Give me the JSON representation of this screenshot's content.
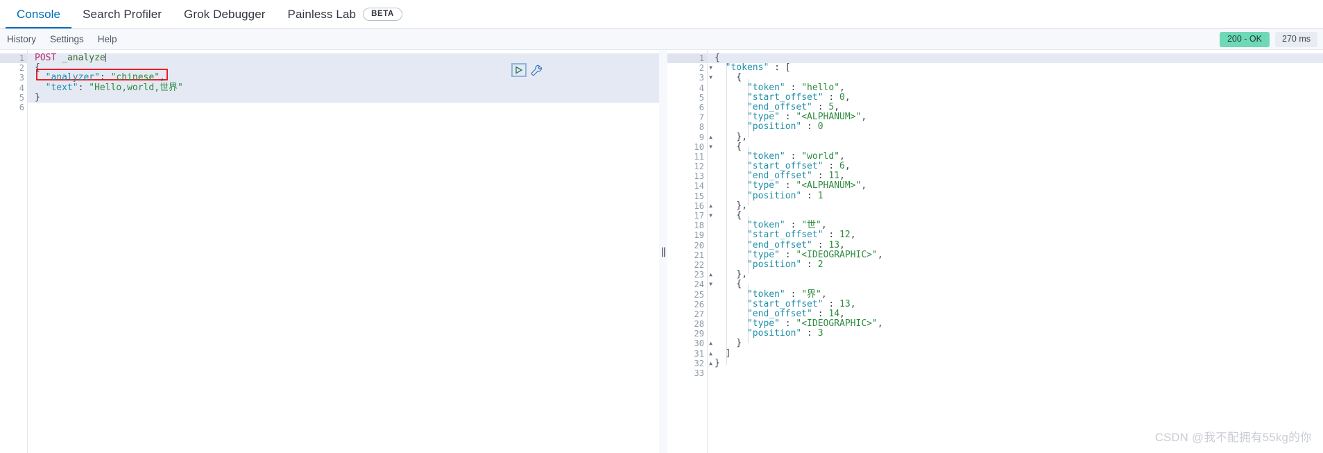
{
  "tabs": [
    {
      "label": "Console",
      "active": true,
      "badge": null
    },
    {
      "label": "Search Profiler",
      "active": false,
      "badge": null
    },
    {
      "label": "Grok Debugger",
      "active": false,
      "badge": null
    },
    {
      "label": "Painless Lab",
      "active": false,
      "badge": "BETA"
    }
  ],
  "subnav": [
    {
      "label": "History"
    },
    {
      "label": "Settings"
    },
    {
      "label": "Help"
    }
  ],
  "status": {
    "code_label": "200 - OK",
    "time_label": "270 ms",
    "ok_color": "#6fd8b6",
    "time_bg": "#e9edf3"
  },
  "request_editor": {
    "line_numbers": [
      "1",
      "2",
      "3",
      "4",
      "5",
      "6"
    ],
    "folds": {
      "2": "down",
      "5": "up"
    },
    "lines": [
      {
        "n": 1,
        "tokens": [
          {
            "t": "POST ",
            "c": "k-method"
          },
          {
            "t": "_analyze",
            "c": "k-url"
          }
        ],
        "caret": true
      },
      {
        "n": 2,
        "tokens": [
          {
            "t": "{",
            "c": "k-brace"
          }
        ]
      },
      {
        "n": 3,
        "tokens": [
          {
            "t": "  \"analyzer\"",
            "c": "k-key"
          },
          {
            "t": ": ",
            "c": "k-punct"
          },
          {
            "t": "\"chinese\"",
            "c": "k-str"
          },
          {
            "t": ",",
            "c": "k-punct"
          }
        ]
      },
      {
        "n": 4,
        "tokens": [
          {
            "t": "  \"text\"",
            "c": "k-key"
          },
          {
            "t": ": ",
            "c": "k-punct"
          },
          {
            "t": "\"Hello,world,世界\"",
            "c": "k-str"
          }
        ]
      },
      {
        "n": 5,
        "tokens": [
          {
            "t": "}",
            "c": "k-brace"
          }
        ]
      },
      {
        "n": 6,
        "tokens": [
          {
            "t": "",
            "c": "k-punct"
          }
        ]
      }
    ],
    "raw_text": "POST _analyze\n{\n  \"analyzer\": \"chinese\",\n  \"text\": \"Hello,world,世界\"\n}\n",
    "highlight_annotation": "red-box-around-text-line"
  },
  "actions": {
    "play_label": "▷",
    "play_title": "send-request",
    "wrench_title": "request-options"
  },
  "splitter": {
    "grip": "||"
  },
  "response_editor": {
    "line_numbers": [
      "1",
      "2",
      "3",
      "4",
      "5",
      "6",
      "7",
      "8",
      "9",
      "10",
      "11",
      "12",
      "13",
      "14",
      "15",
      "16",
      "17",
      "18",
      "19",
      "20",
      "21",
      "22",
      "23",
      "24",
      "25",
      "26",
      "27",
      "28",
      "29",
      "30",
      "31",
      "32",
      "33"
    ],
    "folds": {
      "1": "down",
      "2": "down",
      "3": "down",
      "9": "up",
      "10": "down",
      "16": "up",
      "17": "down",
      "23": "up",
      "24": "down",
      "30": "up",
      "31": "up",
      "32": "up"
    },
    "lines": [
      {
        "n": 1,
        "tokens": [
          {
            "t": "{",
            "c": "k-brace"
          }
        ]
      },
      {
        "n": 2,
        "tokens": [
          {
            "t": "  \"tokens\"",
            "c": "k-key"
          },
          {
            "t": " : ",
            "c": "k-punct"
          },
          {
            "t": "[",
            "c": "k-brace"
          }
        ]
      },
      {
        "n": 3,
        "tokens": [
          {
            "t": "    {",
            "c": "k-brace"
          }
        ]
      },
      {
        "n": 4,
        "tokens": [
          {
            "t": "      \"token\"",
            "c": "k-key"
          },
          {
            "t": " : ",
            "c": "k-punct"
          },
          {
            "t": "\"hello\"",
            "c": "k-str"
          },
          {
            "t": ",",
            "c": "k-punct"
          }
        ]
      },
      {
        "n": 5,
        "tokens": [
          {
            "t": "      \"start_offset\"",
            "c": "k-key"
          },
          {
            "t": " : ",
            "c": "k-punct"
          },
          {
            "t": "0",
            "c": "k-num"
          },
          {
            "t": ",",
            "c": "k-punct"
          }
        ]
      },
      {
        "n": 6,
        "tokens": [
          {
            "t": "      \"end_offset\"",
            "c": "k-key"
          },
          {
            "t": " : ",
            "c": "k-punct"
          },
          {
            "t": "5",
            "c": "k-num"
          },
          {
            "t": ",",
            "c": "k-punct"
          }
        ]
      },
      {
        "n": 7,
        "tokens": [
          {
            "t": "      \"type\"",
            "c": "k-key"
          },
          {
            "t": " : ",
            "c": "k-punct"
          },
          {
            "t": "\"<ALPHANUM>\"",
            "c": "k-str"
          },
          {
            "t": ",",
            "c": "k-punct"
          }
        ]
      },
      {
        "n": 8,
        "tokens": [
          {
            "t": "      \"position\"",
            "c": "k-key"
          },
          {
            "t": " : ",
            "c": "k-punct"
          },
          {
            "t": "0",
            "c": "k-num"
          }
        ]
      },
      {
        "n": 9,
        "tokens": [
          {
            "t": "    },",
            "c": "k-brace"
          }
        ]
      },
      {
        "n": 10,
        "tokens": [
          {
            "t": "    {",
            "c": "k-brace"
          }
        ]
      },
      {
        "n": 11,
        "tokens": [
          {
            "t": "      \"token\"",
            "c": "k-key"
          },
          {
            "t": " : ",
            "c": "k-punct"
          },
          {
            "t": "\"world\"",
            "c": "k-str"
          },
          {
            "t": ",",
            "c": "k-punct"
          }
        ]
      },
      {
        "n": 12,
        "tokens": [
          {
            "t": "      \"start_offset\"",
            "c": "k-key"
          },
          {
            "t": " : ",
            "c": "k-punct"
          },
          {
            "t": "6",
            "c": "k-num"
          },
          {
            "t": ",",
            "c": "k-punct"
          }
        ]
      },
      {
        "n": 13,
        "tokens": [
          {
            "t": "      \"end_offset\"",
            "c": "k-key"
          },
          {
            "t": " : ",
            "c": "k-punct"
          },
          {
            "t": "11",
            "c": "k-num"
          },
          {
            "t": ",",
            "c": "k-punct"
          }
        ]
      },
      {
        "n": 14,
        "tokens": [
          {
            "t": "      \"type\"",
            "c": "k-key"
          },
          {
            "t": " : ",
            "c": "k-punct"
          },
          {
            "t": "\"<ALPHANUM>\"",
            "c": "k-str"
          },
          {
            "t": ",",
            "c": "k-punct"
          }
        ]
      },
      {
        "n": 15,
        "tokens": [
          {
            "t": "      \"position\"",
            "c": "k-key"
          },
          {
            "t": " : ",
            "c": "k-punct"
          },
          {
            "t": "1",
            "c": "k-num"
          }
        ]
      },
      {
        "n": 16,
        "tokens": [
          {
            "t": "    },",
            "c": "k-brace"
          }
        ]
      },
      {
        "n": 17,
        "tokens": [
          {
            "t": "    {",
            "c": "k-brace"
          }
        ]
      },
      {
        "n": 18,
        "tokens": [
          {
            "t": "      \"token\"",
            "c": "k-key"
          },
          {
            "t": " : ",
            "c": "k-punct"
          },
          {
            "t": "\"世\"",
            "c": "k-str"
          },
          {
            "t": ",",
            "c": "k-punct"
          }
        ]
      },
      {
        "n": 19,
        "tokens": [
          {
            "t": "      \"start_offset\"",
            "c": "k-key"
          },
          {
            "t": " : ",
            "c": "k-punct"
          },
          {
            "t": "12",
            "c": "k-num"
          },
          {
            "t": ",",
            "c": "k-punct"
          }
        ]
      },
      {
        "n": 20,
        "tokens": [
          {
            "t": "      \"end_offset\"",
            "c": "k-key"
          },
          {
            "t": " : ",
            "c": "k-punct"
          },
          {
            "t": "13",
            "c": "k-num"
          },
          {
            "t": ",",
            "c": "k-punct"
          }
        ]
      },
      {
        "n": 21,
        "tokens": [
          {
            "t": "      \"type\"",
            "c": "k-key"
          },
          {
            "t": " : ",
            "c": "k-punct"
          },
          {
            "t": "\"<IDEOGRAPHIC>\"",
            "c": "k-str"
          },
          {
            "t": ",",
            "c": "k-punct"
          }
        ]
      },
      {
        "n": 22,
        "tokens": [
          {
            "t": "      \"position\"",
            "c": "k-key"
          },
          {
            "t": " : ",
            "c": "k-punct"
          },
          {
            "t": "2",
            "c": "k-num"
          }
        ]
      },
      {
        "n": 23,
        "tokens": [
          {
            "t": "    },",
            "c": "k-brace"
          }
        ]
      },
      {
        "n": 24,
        "tokens": [
          {
            "t": "    {",
            "c": "k-brace"
          }
        ]
      },
      {
        "n": 25,
        "tokens": [
          {
            "t": "      \"token\"",
            "c": "k-key"
          },
          {
            "t": " : ",
            "c": "k-punct"
          },
          {
            "t": "\"界\"",
            "c": "k-str"
          },
          {
            "t": ",",
            "c": "k-punct"
          }
        ]
      },
      {
        "n": 26,
        "tokens": [
          {
            "t": "      \"start_offset\"",
            "c": "k-key"
          },
          {
            "t": " : ",
            "c": "k-punct"
          },
          {
            "t": "13",
            "c": "k-num"
          },
          {
            "t": ",",
            "c": "k-punct"
          }
        ]
      },
      {
        "n": 27,
        "tokens": [
          {
            "t": "      \"end_offset\"",
            "c": "k-key"
          },
          {
            "t": " : ",
            "c": "k-punct"
          },
          {
            "t": "14",
            "c": "k-num"
          },
          {
            "t": ",",
            "c": "k-punct"
          }
        ]
      },
      {
        "n": 28,
        "tokens": [
          {
            "t": "      \"type\"",
            "c": "k-key"
          },
          {
            "t": " : ",
            "c": "k-punct"
          },
          {
            "t": "\"<IDEOGRAPHIC>\"",
            "c": "k-str"
          },
          {
            "t": ",",
            "c": "k-punct"
          }
        ]
      },
      {
        "n": 29,
        "tokens": [
          {
            "t": "      \"position\"",
            "c": "k-key"
          },
          {
            "t": " : ",
            "c": "k-punct"
          },
          {
            "t": "3",
            "c": "k-num"
          }
        ]
      },
      {
        "n": 30,
        "tokens": [
          {
            "t": "    }",
            "c": "k-brace"
          }
        ]
      },
      {
        "n": 31,
        "tokens": [
          {
            "t": "  ]",
            "c": "k-brace"
          }
        ]
      },
      {
        "n": 32,
        "tokens": [
          {
            "t": "}",
            "c": "k-brace"
          }
        ]
      },
      {
        "n": 33,
        "tokens": [
          {
            "t": "",
            "c": "k-punct"
          }
        ]
      }
    ]
  },
  "watermark": {
    "text": "CSDN @我不配拥有55kg的你"
  }
}
